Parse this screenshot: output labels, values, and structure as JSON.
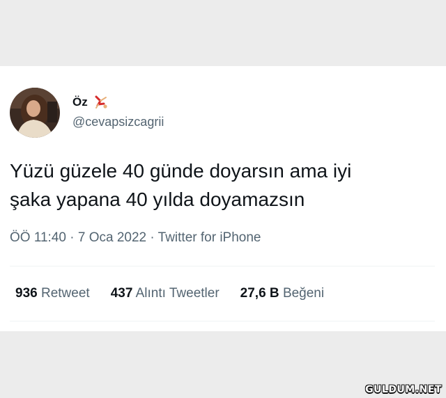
{
  "tweet": {
    "display_name": "Öz",
    "name_emoji": "cartwheel-person-emoji",
    "handle": "@cevapsizcagrii",
    "text_line1": "Yüzü güzele 40 günde doyarsın ama iyi",
    "text_line2": "şaka yapana 40 yılda doyamazsın",
    "timestamp": "ÖÖ 11:40 · 7 Oca 2022 · Twitter for iPhone"
  },
  "stats": {
    "retweets_count": "936",
    "retweets_label": "Retweet",
    "quotes_count": "437",
    "quotes_label": "Alıntı Tweetler",
    "likes_count": "27,6 B",
    "likes_label": "Beğeni"
  },
  "watermark": "GULDUM.NET",
  "colors": {
    "text": "#0f1419",
    "secondary": "#536471",
    "background": "#ececec",
    "card": "#ffffff"
  }
}
